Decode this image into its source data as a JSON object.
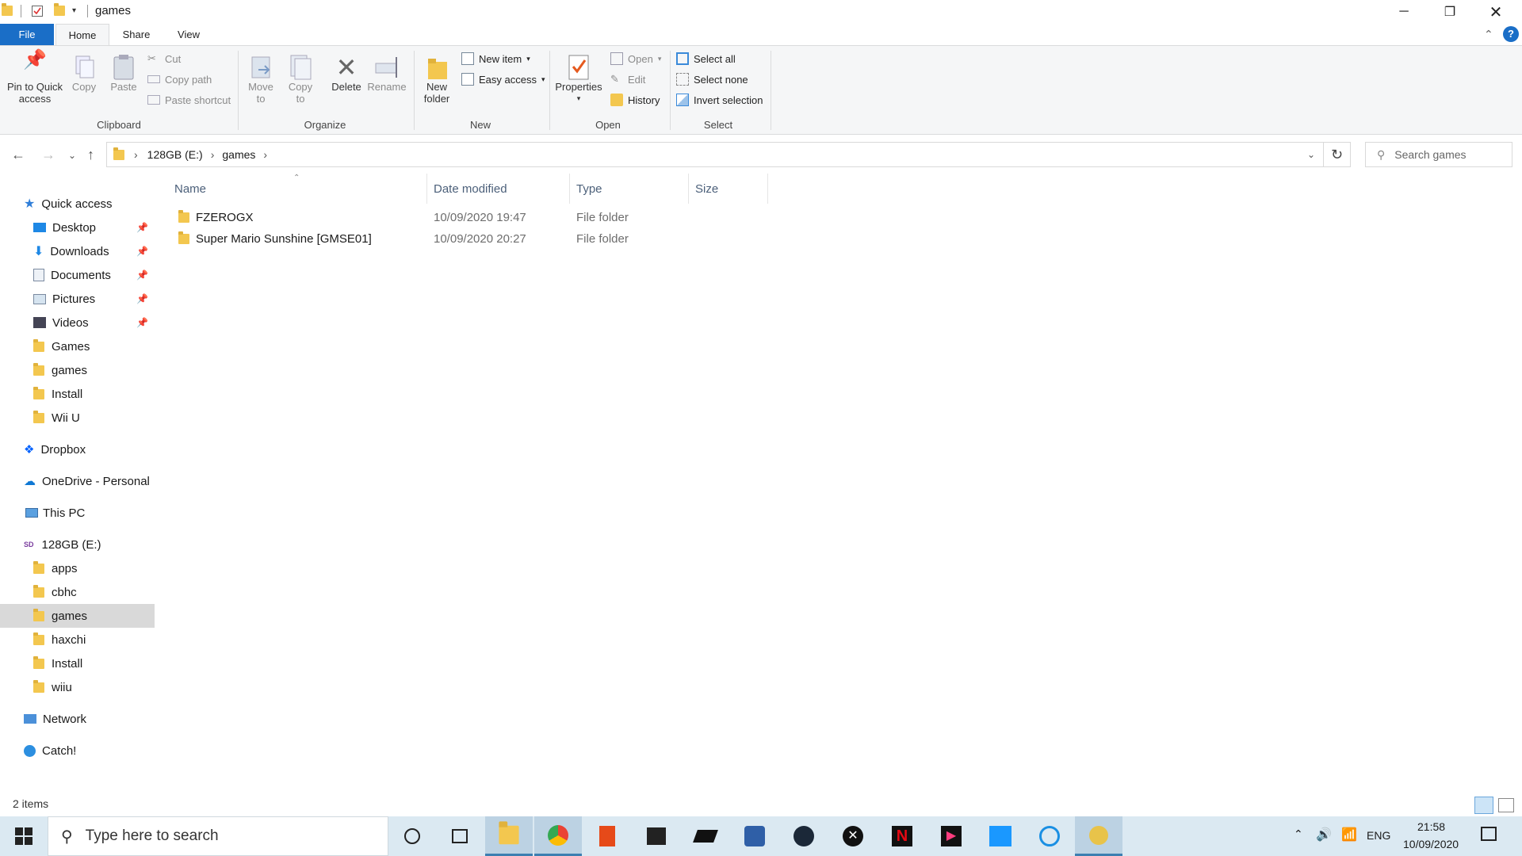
{
  "window": {
    "title": "games"
  },
  "ribbon_tabs": [
    "File",
    "Home",
    "Share",
    "View"
  ],
  "ribbon": {
    "clipboard": {
      "pin": "Pin to Quick\naccess",
      "copy": "Copy",
      "paste": "Paste",
      "cut": "Cut",
      "copy_path": "Copy path",
      "paste_shortcut": "Paste shortcut",
      "label": "Clipboard"
    },
    "organize": {
      "move_to": "Move\nto",
      "copy_to": "Copy\nto",
      "delete": "Delete",
      "rename": "Rename",
      "label": "Organize"
    },
    "new": {
      "new_folder": "New\nfolder",
      "new_item": "New item",
      "easy_access": "Easy access",
      "label": "New"
    },
    "open": {
      "properties": "Properties",
      "open": "Open",
      "edit": "Edit",
      "history": "History",
      "label": "Open"
    },
    "select": {
      "select_all": "Select all",
      "select_none": "Select none",
      "invert": "Invert selection",
      "label": "Select"
    }
  },
  "address": {
    "crumbs": [
      "128GB (E:)",
      "games"
    ],
    "search_placeholder": "Search games"
  },
  "sidebar": {
    "quick_access": "Quick access",
    "pinned": [
      "Desktop",
      "Downloads",
      "Documents",
      "Pictures",
      "Videos"
    ],
    "recent": [
      "Games",
      "games",
      "Install",
      "Wii U"
    ],
    "dropbox": "Dropbox",
    "onedrive": "OneDrive - Personal",
    "thispc": "This PC",
    "drive": "128GB (E:)",
    "drive_folders": [
      "apps",
      "cbhc",
      "games",
      "haxchi",
      "Install",
      "wiiu"
    ],
    "network": "Network",
    "catch": "Catch!"
  },
  "columns": [
    "Name",
    "Date modified",
    "Type",
    "Size"
  ],
  "files": [
    {
      "name": "FZEROGX",
      "date": "10/09/2020 19:47",
      "type": "File folder",
      "size": ""
    },
    {
      "name": "Super Mario Sunshine [GMSE01]",
      "date": "10/09/2020 20:27",
      "type": "File folder",
      "size": ""
    }
  ],
  "status": {
    "items": "2 items"
  },
  "taskbar": {
    "search_placeholder": "Type here to search",
    "lang": "ENG",
    "time": "21:58",
    "date": "10/09/2020"
  }
}
